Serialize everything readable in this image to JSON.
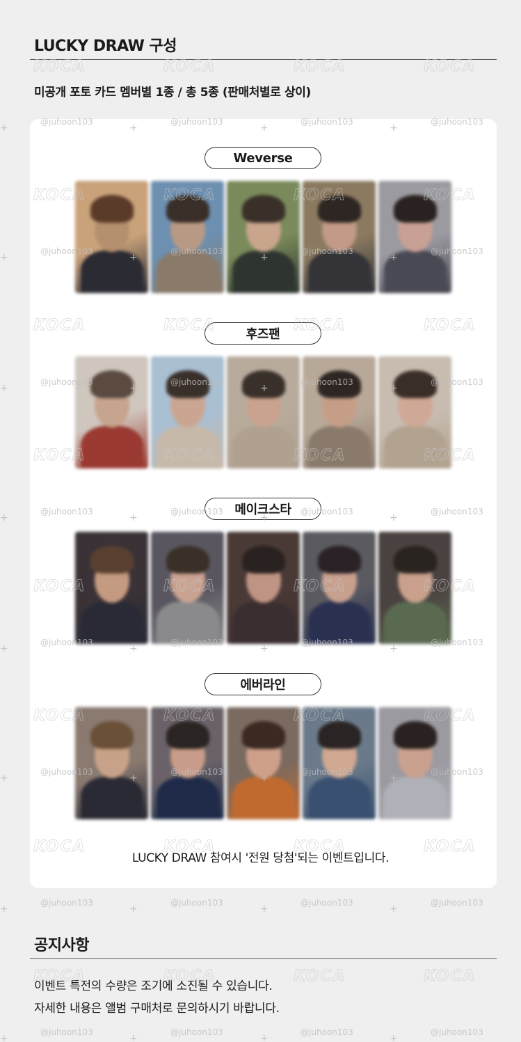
{
  "lucky_draw": {
    "title": "LUCKY DRAW 구성",
    "subtitle": "미공개 포토 카드 멤버별 1종 / 총 5종 (판매처별로 상이)",
    "groups": [
      {
        "label": "Weverse"
      },
      {
        "label": "후즈팬"
      },
      {
        "label": "메이크스타"
      },
      {
        "label": "에버라인"
      }
    ],
    "footnote": "LUCKY DRAW 참여시 '전원 당첨'되는 이벤트입니다."
  },
  "notice": {
    "title": "공지사항",
    "lines": [
      "이벤트 특전의 수량은 조기에 소진될 수 있습니다.",
      "자세한 내용은 앨범 구매처로 문의하시기 바랍니다."
    ]
  },
  "watermarks": {
    "logo": "KOCA",
    "handle": "@juhoon103"
  },
  "colors": {
    "background": "#efefef",
    "panel": "#ffffff",
    "text": "#1a1a1a",
    "rule": "#5a5a5a"
  }
}
